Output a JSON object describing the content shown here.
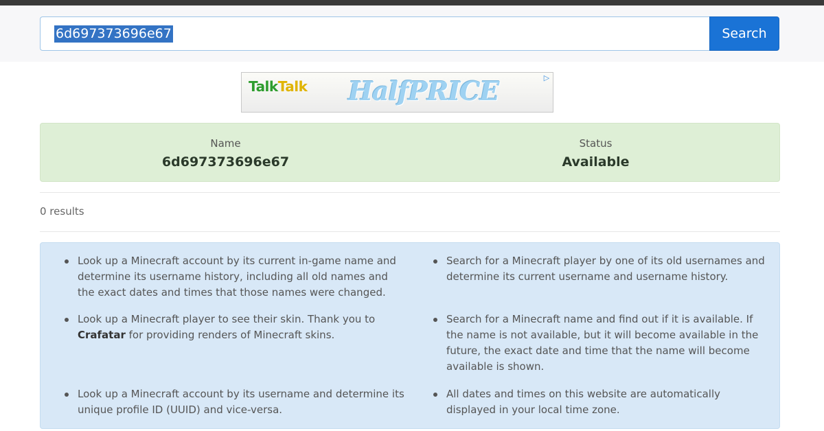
{
  "search": {
    "query": "6d697373696e67",
    "button_label": "Search"
  },
  "ad": {
    "brand_talk": "Talk",
    "brand_talk2": "Talk",
    "promo_text": "HalfPRICE",
    "adchoices_icon": "adchoices-icon"
  },
  "status_panel": {
    "name_label": "Name",
    "name_value": "6d697373696e67",
    "status_label": "Status",
    "status_value": "Available"
  },
  "results_text": "0 results",
  "info": {
    "item1": "Look up a Minecraft account by its current in-game name and determine its username history, including all old names and the exact dates and times that those names were changed.",
    "item2_a": "Look up a Minecraft player to see their skin. Thank you to ",
    "item2_link": "Crafatar",
    "item2_b": " for providing renders of Minecraft skins.",
    "item3": "Look up a Minecraft account by its username and determine its unique profile ID (UUID) and vice-versa.",
    "item4": "Search for a Minecraft player by one of its old usernames and determine its current username and username history.",
    "item5": "Search for a Minecraft name and find out if it is available. If the name is not available, but it will become available in the future, the exact date and time that the name will become available is shown.",
    "item6": "All dates and times on this website are automatically displayed in your local time zone."
  }
}
